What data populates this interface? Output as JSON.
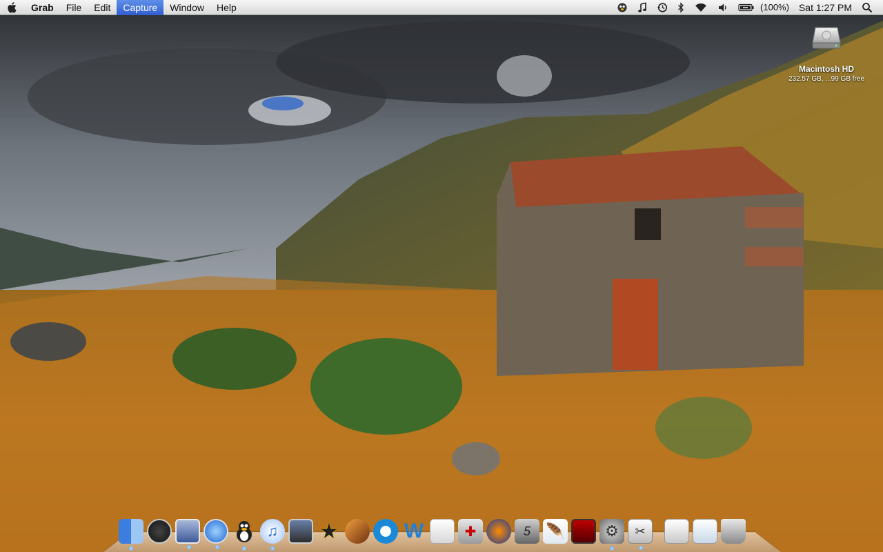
{
  "menubar": {
    "apple_icon": "apple-icon",
    "app_name": "Grab",
    "menus": [
      "File",
      "Edit",
      "Capture",
      "Window",
      "Help"
    ],
    "active_menu": "Capture",
    "status": {
      "battery_percent": "(100%)",
      "clock": "Sat 1:27 PM"
    },
    "status_icons": [
      "adium-icon",
      "music-note-icon",
      "time-machine-icon",
      "bluetooth-icon",
      "wifi-icon",
      "volume-icon",
      "battery-icon",
      "spotlight-icon"
    ]
  },
  "desktop": {
    "disk": {
      "name": "Macintosh HD",
      "free": "232.57 GB, ...99 GB free"
    }
  },
  "dock": {
    "apps": [
      "finder",
      "activity-monitor",
      "mail",
      "safari",
      "adium",
      "itunes",
      "iphoto",
      "imovie",
      "garageband",
      "quicktime",
      "microsoft-word",
      "textedit",
      "tool",
      "audacity",
      "logic",
      "feather-app",
      "photo-booth",
      "system-preferences",
      "grab"
    ],
    "docs": [
      "documents-stack",
      "downloads-stack",
      "trash"
    ]
  }
}
